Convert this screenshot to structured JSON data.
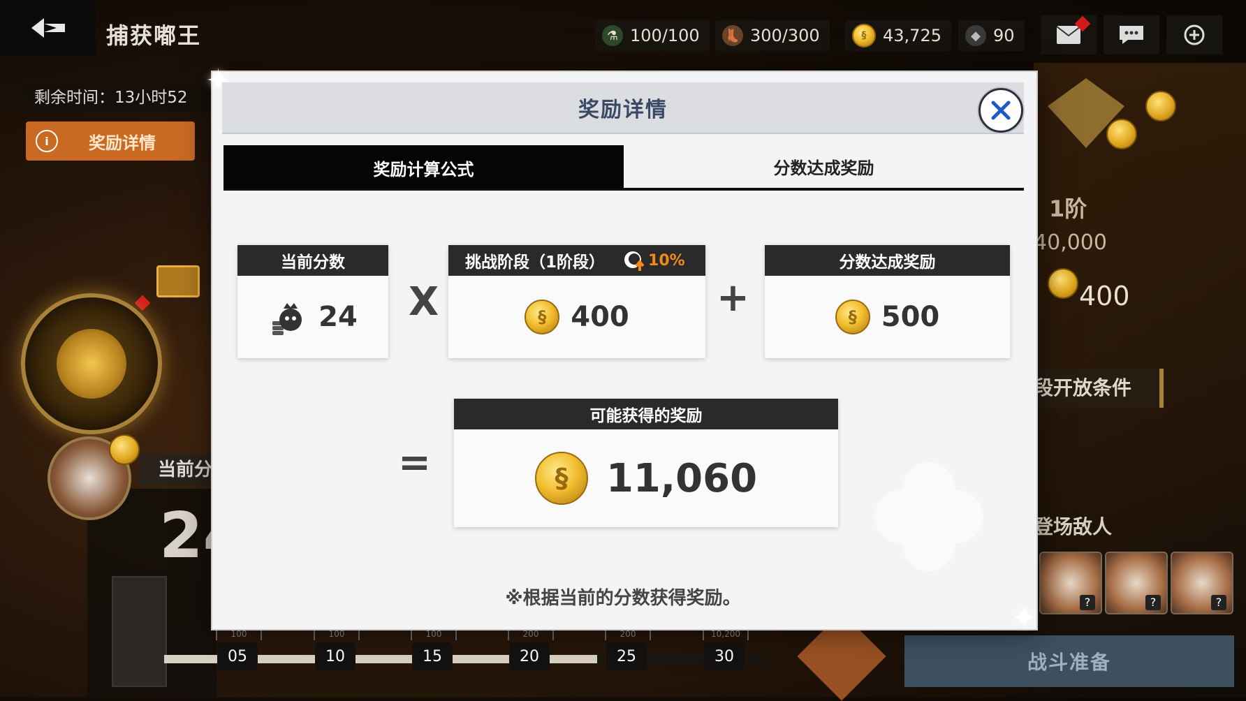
{
  "header": {
    "title": "捕获嘟王",
    "resources": [
      {
        "icon": "stamina-bottle-icon",
        "value": "100/100"
      },
      {
        "icon": "boot-icon",
        "value": "300/300"
      },
      {
        "icon": "gold-coin-icon",
        "value": "43,725"
      },
      {
        "icon": "crystal-drop-icon",
        "value": "90"
      }
    ]
  },
  "left": {
    "timer": "剩余时间：13小时52",
    "reward_button": "奖励详情",
    "current_score_label": "当前分",
    "current_score_value": "24"
  },
  "progress": {
    "milestones": [
      {
        "label": "05",
        "top": "100"
      },
      {
        "label": "10",
        "top": "100"
      },
      {
        "label": "15",
        "top": "100"
      },
      {
        "label": "20",
        "top": "200"
      },
      {
        "label": "25",
        "top": "200"
      },
      {
        "label": "30",
        "top": "10,200"
      }
    ]
  },
  "right": {
    "stage": "1阶",
    "score": "40,000",
    "reward": "400",
    "condition": "段开放条件",
    "enemies_label": "登场敌人",
    "enemy_unknown": "?",
    "battle_button": "战斗准备"
  },
  "modal": {
    "title": "奖励详情",
    "tabs": [
      "奖励计算公式",
      "分数达成奖励"
    ],
    "current_score": {
      "label": "当前分数",
      "value": "24"
    },
    "times": "X",
    "stage": {
      "label": "挑战阶段（1阶段）",
      "bonus": "10%",
      "value": "400"
    },
    "plus": "+",
    "score_reward": {
      "label": "分数达成奖励",
      "value": "500"
    },
    "equals": "=",
    "possible": {
      "label": "可能获得的奖励",
      "value": "11,060"
    },
    "note": "※根据当前的分数获得奖励。"
  },
  "colors": {
    "accent": "#c86a22",
    "modal_title": "#3a4a66",
    "bonus": "#f08a1a",
    "battle_button": "#3c5060"
  }
}
